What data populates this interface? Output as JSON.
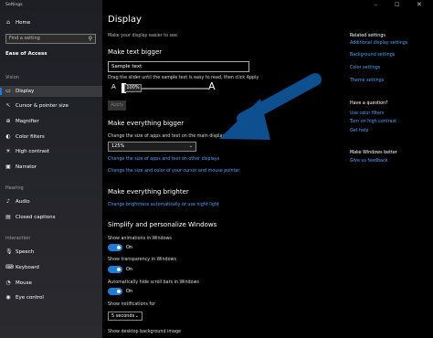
{
  "window": {
    "title": "Settings"
  },
  "sidebar": {
    "home": "Home",
    "search_placeholder": "Find a setting",
    "section": "Ease of Access",
    "groups": {
      "vision": "Vision",
      "hearing": "Hearing",
      "interaction": "Interaction"
    },
    "vision_items": [
      {
        "label": "Display",
        "icon": "display-icon"
      },
      {
        "label": "Cursor & pointer size",
        "icon": "cursor-icon"
      },
      {
        "label": "Magnifier",
        "icon": "magnifier-icon"
      },
      {
        "label": "Color filters",
        "icon": "color-filter-icon"
      },
      {
        "label": "High contrast",
        "icon": "contrast-icon"
      },
      {
        "label": "Narrator",
        "icon": "narrator-icon"
      }
    ],
    "hearing_items": [
      {
        "label": "Audio",
        "icon": "audio-icon"
      },
      {
        "label": "Closed captions",
        "icon": "captions-icon"
      }
    ],
    "interaction_items": [
      {
        "label": "Speech",
        "icon": "speech-icon"
      },
      {
        "label": "Keyboard",
        "icon": "keyboard-icon"
      },
      {
        "label": "Mouse",
        "icon": "mouse-icon"
      },
      {
        "label": "Eye control",
        "icon": "eye-icon"
      }
    ]
  },
  "main": {
    "title": "Display",
    "subtitle": "Make your display easier to see.",
    "text_bigger": {
      "heading": "Make text bigger",
      "sample_value": "Sample text",
      "instruction": "Drag the slider until the sample text is easy to read, then click Apply",
      "small_a": "A",
      "big_a": "A",
      "slider_value": "100%",
      "apply_label": "Apply"
    },
    "everything_bigger": {
      "heading": "Make everything bigger",
      "label": "Change the size of apps and text on the main display",
      "selected": "125%",
      "link1": "Change the size of apps and text on other displays",
      "link2": "Change the size and color of your cursor and mouse pointer"
    },
    "brighter": {
      "heading": "Make everything brighter",
      "link": "Change brightness automatically or use night light"
    },
    "simplify": {
      "heading": "Simplify and personalize Windows",
      "toggles": [
        {
          "label": "Show animations in Windows",
          "state": "On"
        },
        {
          "label": "Show transparency in Windows",
          "state": "On"
        },
        {
          "label": "Automatically hide scroll bars in Windows",
          "state": "On"
        }
      ],
      "notif_label": "Show notifications for",
      "notif_value": "5 seconds",
      "bg_label": "Show desktop background image"
    }
  },
  "right": {
    "related_heading": "Related settings",
    "related_links": [
      "Additional display settings",
      "Background settings",
      "Color settings",
      "Theme settings"
    ],
    "question_heading": "Have a question?",
    "question_links": [
      "Use color filters",
      "Turn on high contrast",
      "Get help"
    ],
    "better_heading": "Make Windows better",
    "better_link": "Give us feedback"
  },
  "colors": {
    "accent": "#1e7dd6",
    "link": "#4da3ff",
    "arrow": "#0e4f8f"
  }
}
